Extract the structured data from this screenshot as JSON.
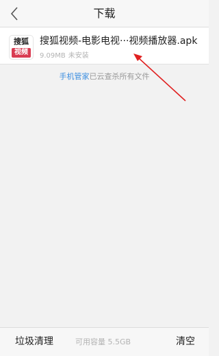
{
  "header": {
    "title": "下载",
    "back_icon": "chevron-left-icon"
  },
  "download_item": {
    "icon_text_top": "搜狐",
    "icon_text_bottom": "视频",
    "file_name": "搜狐视频-电影电视···视频播放器.apk",
    "size": "9.09MB",
    "status": "未安装"
  },
  "scan_note": {
    "link": "手机管家",
    "text": "已云查杀所有文件"
  },
  "footer": {
    "clean_label": "垃圾清理",
    "capacity": "可用容量 5.5GB",
    "clear_label": "清空"
  },
  "colors": {
    "link": "#3a8de0",
    "annotation_arrow": "#e02020",
    "icon_red": "#d93c52"
  }
}
